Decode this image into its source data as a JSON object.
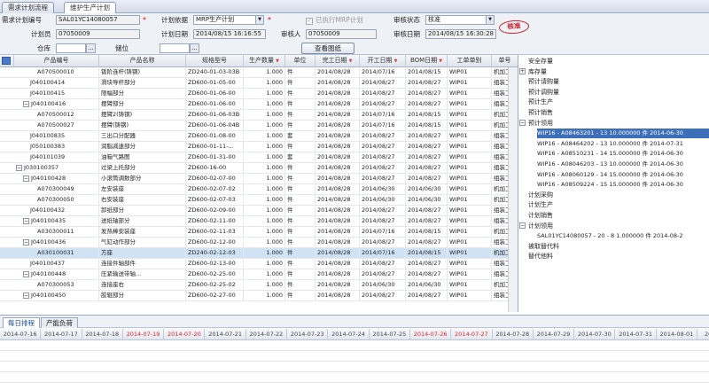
{
  "tabs": [
    "需求计划流程",
    "维护生产计划"
  ],
  "form": {
    "plan_no_label": "需求计划编号",
    "plan_no": "SAL01YC14080057",
    "plan_basis_label": "计划依据",
    "plan_basis": "MRP生产计划",
    "mrp_executed_label": "已执行MRP计划",
    "review_status_label": "审核状态",
    "review_status": "核准",
    "seal_text": "核准",
    "planner_label": "计划员",
    "planner": "07050009",
    "plan_date_label": "计划日期",
    "plan_date": "2014/08/15 16:16:55",
    "reviewer_label": "审核人",
    "reviewer": "07050009",
    "review_date_label": "审核日期",
    "review_date": "2014/08/15 16:30:28",
    "warehouse_label": "仓库",
    "location_label": "储位",
    "view_drawing_button": "查看图纸",
    "ellipsis": "..."
  },
  "grid": {
    "columns": [
      "产品编号",
      "产品名称",
      "规格型号",
      "生产数量",
      "单位",
      "完工日期",
      "开工日期",
      "BOM日期",
      "工单单别",
      "单号"
    ],
    "rows": [
      {
        "code": "A070500010",
        "name": "钣阶连杆(铸钢)",
        "spec": "ZD240-01-03-03B",
        "qty": "1.000",
        "unit": "件",
        "finish": "2014/08/28",
        "start": "2014/07/16",
        "bom": "2014/08/15",
        "type": "WIP01",
        "no": "机加工",
        "indent": 3,
        "exp": ""
      },
      {
        "code": "J040100414",
        "name": "滑块导杆部分",
        "spec": "ZD600-01-05-00",
        "qty": "1.000",
        "unit": "件",
        "finish": "2014/08/28",
        "start": "2014/08/27",
        "bom": "2014/08/27",
        "type": "WIP01",
        "no": "组装工",
        "indent": 2,
        "exp": ""
      },
      {
        "code": "J040100415",
        "name": "限幅部分",
        "spec": "ZD600-01-06-00",
        "qty": "1.000",
        "unit": "件",
        "finish": "2014/08/28",
        "start": "2014/08/27",
        "bom": "2014/08/27",
        "type": "WIP01",
        "no": "组装工",
        "indent": 2,
        "exp": ""
      },
      {
        "code": "J040100416",
        "name": "摆臂部分",
        "spec": "ZD600-01-06-00",
        "qty": "1.000",
        "unit": "件",
        "finish": "2014/08/28",
        "start": "2014/08/27",
        "bom": "2014/08/27",
        "type": "WIP01",
        "no": "组装工",
        "indent": 1,
        "exp": "−"
      },
      {
        "code": "A070500012",
        "name": "摆臂2(铸钢)",
        "spec": "ZD600-01-06-03B",
        "qty": "1.000",
        "unit": "件",
        "finish": "2014/08/28",
        "start": "2014/07/16",
        "bom": "2014/08/15",
        "type": "WIP01",
        "no": "机加工",
        "indent": 3,
        "exp": ""
      },
      {
        "code": "A070500027",
        "name": "摆臂(铸钢)",
        "spec": "ZD600-01-06-04B",
        "qty": "1.000",
        "unit": "件",
        "finish": "2014/08/28",
        "start": "2014/07/16",
        "bom": "2014/08/15",
        "type": "WIP01",
        "no": "机加工",
        "indent": 3,
        "exp": ""
      },
      {
        "code": "J040100835",
        "name": "三出口分配器",
        "spec": "ZD600-01-08-00",
        "qty": "1.000",
        "unit": "套",
        "finish": "2014/08/28",
        "start": "2014/08/27",
        "bom": "2014/08/27",
        "type": "WIP01",
        "no": "组装工",
        "indent": 2,
        "exp": ""
      },
      {
        "code": "J050100383",
        "name": "润脂减速部分",
        "spec": "ZD600-01-11-...",
        "qty": "1.000",
        "unit": "件",
        "finish": "2014/08/28",
        "start": "2014/08/27",
        "bom": "2014/08/27",
        "type": "WIP01",
        "no": "组装工",
        "indent": 2,
        "exp": ""
      },
      {
        "code": "J040101039",
        "name": "油箱气路图",
        "spec": "ZD600-01-31-00",
        "qty": "1.000",
        "unit": "套",
        "finish": "2014/08/28",
        "start": "2014/08/27",
        "bom": "2014/08/27",
        "type": "WIP01",
        "no": "组装工",
        "indent": 2,
        "exp": ""
      },
      {
        "code": "J030100357",
        "name": "过梁上托部分",
        "spec": "ZD600-16-00",
        "qty": "1.000",
        "unit": "件",
        "finish": "2014/08/28",
        "start": "2014/08/27",
        "bom": "2014/08/27",
        "type": "WIP01",
        "no": "组装工",
        "indent": 0,
        "exp": "−"
      },
      {
        "code": "J040100428",
        "name": "小滚筒调数部分",
        "spec": "ZD600-02-07-00",
        "qty": "1.000",
        "unit": "件",
        "finish": "2014/08/28",
        "start": "2014/08/27",
        "bom": "2014/08/27",
        "type": "WIP01",
        "no": "组装工",
        "indent": 1,
        "exp": "−"
      },
      {
        "code": "A070300049",
        "name": "左安装座",
        "spec": "ZD600-02-07-02",
        "qty": "1.000",
        "unit": "件",
        "finish": "2014/08/28",
        "start": "2014/06/30",
        "bom": "2014/06/30",
        "type": "WIP01",
        "no": "机加工",
        "indent": 3,
        "exp": ""
      },
      {
        "code": "A070300050",
        "name": "右安装座",
        "spec": "ZD600-02-07-03",
        "qty": "1.000",
        "unit": "件",
        "finish": "2014/08/28",
        "start": "2014/06/30",
        "bom": "2014/06/30",
        "type": "WIP01",
        "no": "机加工",
        "indent": 3,
        "exp": ""
      },
      {
        "code": "J040100432",
        "name": "卸纸部分",
        "spec": "ZD600-02-09-00",
        "qty": "1.000",
        "unit": "件",
        "finish": "2014/08/28",
        "start": "2014/08/27",
        "bom": "2014/08/27",
        "type": "WIP01",
        "no": "组装工",
        "indent": 2,
        "exp": ""
      },
      {
        "code": "J040100435",
        "name": "送纸轴部分",
        "spec": "ZD600-02-11-00",
        "qty": "1.000",
        "unit": "件",
        "finish": "2014/08/28",
        "start": "2014/08/27",
        "bom": "2014/08/27",
        "type": "WIP01",
        "no": "组装工",
        "indent": 1,
        "exp": "−"
      },
      {
        "code": "A030300011",
        "name": "发热棒安装座",
        "spec": "ZD600-02-11-03",
        "qty": "1.000",
        "unit": "件",
        "finish": "2014/08/28",
        "start": "2014/07/16",
        "bom": "2014/08/15",
        "type": "WIP01",
        "no": "机加工",
        "indent": 3,
        "exp": ""
      },
      {
        "code": "J040100436",
        "name": "气缸动作部分",
        "spec": "ZD600-02-12-00",
        "qty": "1.000",
        "unit": "件",
        "finish": "2014/08/28",
        "start": "2014/08/27",
        "bom": "2014/08/27",
        "type": "WIP01",
        "no": "组装工",
        "indent": 1,
        "exp": "−"
      },
      {
        "code": "A030100031",
        "name": "方座",
        "spec": "ZD240-02-12-03",
        "qty": "1.000",
        "unit": "件",
        "finish": "2014/08/28",
        "start": "2014/07/16",
        "bom": "2014/08/15",
        "type": "WIP01",
        "no": "机加工",
        "indent": 3,
        "exp": "",
        "selected": true
      },
      {
        "code": "J040100437",
        "name": "连接件轴部件",
        "spec": "ZD600-02-13-00",
        "qty": "1.000",
        "unit": "件",
        "finish": "2014/08/28",
        "start": "2014/08/27",
        "bom": "2014/08/27",
        "type": "WIP01",
        "no": "组装工",
        "indent": 2,
        "exp": ""
      },
      {
        "code": "J040100448",
        "name": "压紧输送带轴...",
        "spec": "ZD600-02-25-00",
        "qty": "1.000",
        "unit": "件",
        "finish": "2014/08/28",
        "start": "2014/08/27",
        "bom": "2014/08/27",
        "type": "WIP01",
        "no": "组装工",
        "indent": 1,
        "exp": "−"
      },
      {
        "code": "A070300053",
        "name": "连接座右",
        "spec": "ZD600-02-25-02",
        "qty": "1.000",
        "unit": "件",
        "finish": "2014/08/28",
        "start": "2014/06/30",
        "bom": "2014/06/30",
        "type": "WIP01",
        "no": "机加工",
        "indent": 3,
        "exp": ""
      },
      {
        "code": "J040100450",
        "name": "胶辊部分",
        "spec": "ZD600-02-27-00",
        "qty": "1.000",
        "unit": "件",
        "finish": "2014/08/28",
        "start": "2014/08/27",
        "bom": "2014/08/27",
        "type": "WIP01",
        "no": "组装工",
        "indent": 1,
        "exp": "−"
      }
    ]
  },
  "tree": {
    "nodes": [
      {
        "text": "安全存量",
        "level": 0,
        "box": ""
      },
      {
        "text": "库存量",
        "level": 0,
        "box": "+"
      },
      {
        "text": "预计请购量",
        "level": 0,
        "box": ""
      },
      {
        "text": "预计调购量",
        "level": 0,
        "box": ""
      },
      {
        "text": "预计生产",
        "level": 0,
        "box": ""
      },
      {
        "text": "预计销售",
        "level": 0,
        "box": ""
      },
      {
        "text": "预计领用",
        "level": 0,
        "box": "−"
      },
      {
        "text": "WIP16 - A08463201 - 13  10.000000  件  2014-06-30",
        "level": 1,
        "box": "",
        "sel": true
      },
      {
        "text": "WIP16 - A08464202 - 13  10.000000  件  2014-07-31",
        "level": 1,
        "box": ""
      },
      {
        "text": "WIP16 - A08510231 - 14  15.000000  件  2014-06-30",
        "level": 1,
        "box": ""
      },
      {
        "text": "WIP16 - A08046203 - 13  10.000000  件  2014-06-30",
        "level": 1,
        "box": ""
      },
      {
        "text": "WIP16 - A08060129 - 14  15.000000  件  2014-06-30",
        "level": 1,
        "box": ""
      },
      {
        "text": "WIP16 - A08509224 - 15  15.000000  件  2014-06-30",
        "level": 1,
        "box": ""
      },
      {
        "text": "计划采购",
        "level": 0,
        "box": ""
      },
      {
        "text": "计划生产",
        "level": 0,
        "box": ""
      },
      {
        "text": "计划销售",
        "level": 0,
        "box": ""
      },
      {
        "text": "计划领用",
        "level": 0,
        "box": "−"
      },
      {
        "text": "SAL01YC14080057 - 20 - 8  1.000000  件  2014-08-2",
        "level": 1,
        "box": ""
      },
      {
        "text": "被取替代料",
        "level": 0,
        "box": ""
      },
      {
        "text": "替代他料",
        "level": 0,
        "box": ""
      }
    ]
  },
  "bottom_tabs": [
    "每日排程",
    "产能负荷"
  ],
  "calendar": {
    "dates": [
      {
        "d": "2014-07-16",
        "red": false
      },
      {
        "d": "2014-07-17",
        "red": false
      },
      {
        "d": "2014-07-18",
        "red": false
      },
      {
        "d": "2014-07-19",
        "red": true
      },
      {
        "d": "2014-07-20",
        "red": true
      },
      {
        "d": "2014-07-21",
        "red": false
      },
      {
        "d": "2014-07-22",
        "red": false
      },
      {
        "d": "2014-07-23",
        "red": false
      },
      {
        "d": "2014-07-24",
        "red": false
      },
      {
        "d": "2014-07-25",
        "red": false
      },
      {
        "d": "2014-07-26",
        "red": true
      },
      {
        "d": "2014-07-27",
        "red": true
      },
      {
        "d": "2014-07-28",
        "red": false
      },
      {
        "d": "2014-07-29",
        "red": false
      },
      {
        "d": "2014-07-30",
        "red": false
      },
      {
        "d": "2014-07-31",
        "red": false
      },
      {
        "d": "2014-08-01",
        "red": false
      },
      {
        "d": "2014-08-",
        "red": false
      }
    ]
  },
  "colors": {
    "accent": "#1c4fa0",
    "weekend": "#dd2222",
    "selected_row": "#cfe3f5",
    "seal": "#c8202a"
  }
}
